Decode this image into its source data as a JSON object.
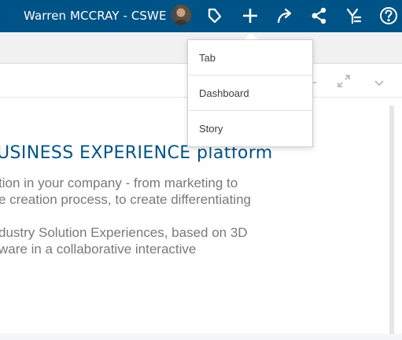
{
  "header": {
    "user_name": "Warren MCCRAY - CSWE",
    "icons": [
      "avatar",
      "compass-tag-icon",
      "add-icon",
      "share-icon",
      "network-share-icon",
      "community-icon",
      "help-icon"
    ]
  },
  "add_menu": {
    "items": [
      {
        "label": "Tab"
      },
      {
        "label": "Dashboard"
      },
      {
        "label": "Story"
      }
    ]
  },
  "widget": {
    "headline": "USINESS EXPERIENCE platform",
    "paragraph1_line1": "tion in your company - from marketing to",
    "paragraph1_line2": "e creation process, to create differentiating",
    "paragraph2_line1": "dustry Solution Experiences, based on 3D",
    "paragraph2_line2": "ware in a collaborative interactive"
  },
  "colors": {
    "brand": "#005386",
    "text_gray": "#77797c",
    "headline": "#005386"
  }
}
